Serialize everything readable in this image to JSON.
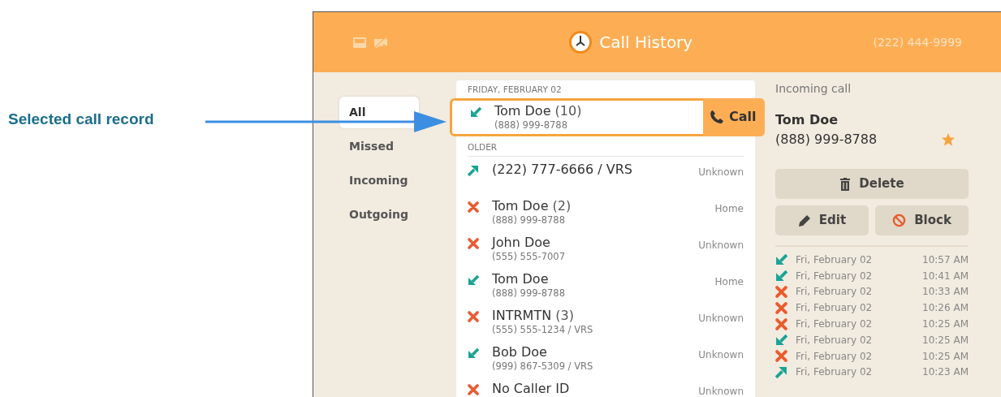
{
  "annotation": {
    "label": "Selected call record"
  },
  "header": {
    "title": "Call History",
    "phone_number": "(222) 444-9999"
  },
  "filters": [
    {
      "label": "All",
      "selected": true
    },
    {
      "label": "Missed",
      "selected": false
    },
    {
      "label": "Incoming",
      "selected": false
    },
    {
      "label": "Outgoing",
      "selected": false
    }
  ],
  "call_list": {
    "sections": [
      {
        "heading": "FRIDAY, FEBRUARY 02",
        "records": [
          {
            "kind": "incoming",
            "name": "Tom Doe",
            "count": "(10)",
            "number": "(888) 999-8788",
            "selected": true,
            "action": "Call"
          }
        ]
      },
      {
        "heading": "OLDER",
        "records": [
          {
            "kind": "outgoing",
            "name": "(222) 777-6666 / VRS",
            "label": "Unknown",
            "selected": false
          },
          {
            "kind": "missed",
            "name": "Tom Doe",
            "count": "(2)",
            "number": "(888) 999-8788",
            "label": "Home",
            "selected": false
          },
          {
            "kind": "missed",
            "name": "John Doe",
            "number": "(555) 555-7007",
            "label": "Unknown",
            "selected": false
          },
          {
            "kind": "incoming",
            "name": "Tom Doe",
            "number": "(888) 999-8788",
            "label": "Home",
            "selected": false
          },
          {
            "kind": "missed",
            "name": "INTRMTN",
            "count": "(3)",
            "number": "(555) 555-1234 / VRS",
            "label": "Unknown",
            "selected": false
          },
          {
            "kind": "incoming",
            "name": "Bob Doe",
            "number": "(999) 867-5309 / VRS",
            "label": "Unknown",
            "selected": false
          },
          {
            "kind": "missed",
            "name": "No Caller ID",
            "label": "Unknown",
            "selected": false
          }
        ]
      }
    ]
  },
  "details": {
    "type": "Incoming call",
    "name": "Tom Doe",
    "number": "(888) 999-8788",
    "favorite": true,
    "buttons": [
      {
        "kind": "delete",
        "label": "Delete"
      },
      {
        "kind": "edit",
        "label": "Edit"
      },
      {
        "kind": "block",
        "label": "Block"
      }
    ],
    "history": [
      {
        "kind": "incoming",
        "date": "Fri, February 02",
        "time": "10:57 AM"
      },
      {
        "kind": "incoming",
        "date": "Fri, February 02",
        "time": "10:41 AM"
      },
      {
        "kind": "missed",
        "date": "Fri, February 02",
        "time": "10:33 AM"
      },
      {
        "kind": "missed",
        "date": "Fri, February 02",
        "time": "10:26 AM"
      },
      {
        "kind": "missed",
        "date": "Fri, February 02",
        "time": "10:25 AM"
      },
      {
        "kind": "incoming",
        "date": "Fri, February 02",
        "time": "10:25 AM"
      },
      {
        "kind": "missed",
        "date": "Fri, February 02",
        "time": "10:25 AM"
      },
      {
        "kind": "outgoing",
        "date": "Fri, February 02",
        "time": "10:23 AM"
      }
    ]
  }
}
